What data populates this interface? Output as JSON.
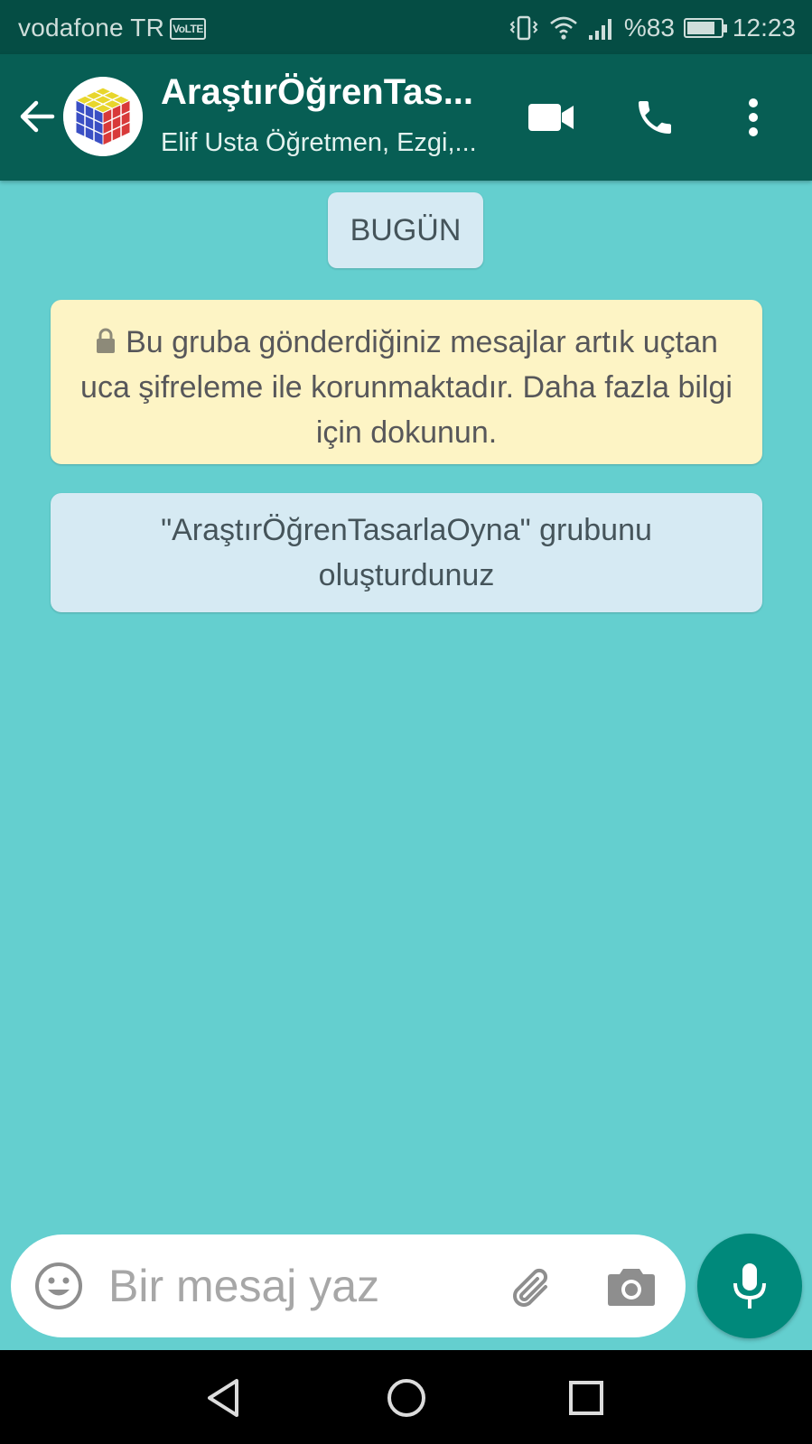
{
  "status_bar": {
    "carrier": "vodafone TR",
    "volte": "VoLTE",
    "battery_percent": "%83",
    "battery_level": 0.83,
    "time": "12:23"
  },
  "header": {
    "group_name": "AraştırÖğrenTas...",
    "participants": "Elif Usta Öğretmen, Ezgi,...",
    "icons": [
      "back-arrow-icon",
      "video-call-icon",
      "phone-icon",
      "more-options-icon"
    ]
  },
  "chat": {
    "date_label": "BUGÜN",
    "encryption_notice": "Bu gruba gönderdiğiniz mesajlar artık uçtan uca şifreleme ile korunmaktadır. Daha fazla bilgi için dokunun.",
    "system_message": "\"AraştırÖğrenTasarlaOyna\" grubunu oluşturdunuz"
  },
  "input": {
    "placeholder": "Bir mesaj yaz",
    "icons": [
      "emoji-icon",
      "attach-icon",
      "camera-icon",
      "mic-icon"
    ]
  },
  "colors": {
    "status_bar": "#054d44",
    "header": "#075e54",
    "chat_background": "#64cfcf",
    "date_chip": "#d6eaf3",
    "encryption_bubble": "#fdf4c5",
    "mic_button": "#00897b"
  }
}
